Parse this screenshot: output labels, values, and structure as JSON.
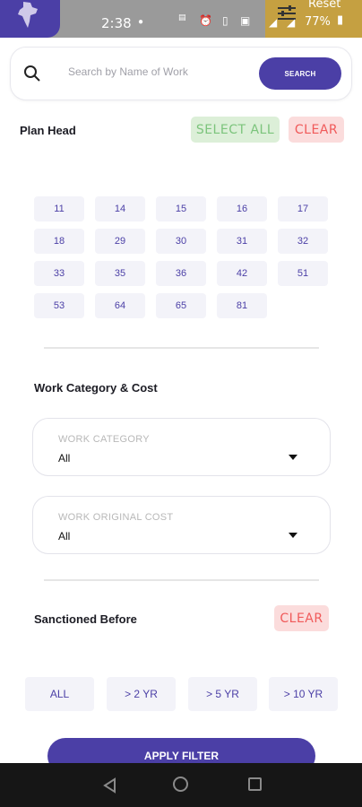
{
  "status_bar": {
    "time": "2:38",
    "battery": "77%",
    "reset_label": "Reset"
  },
  "search": {
    "placeholder": "Search by Name of Work",
    "button_label": "SEARCH"
  },
  "plan_head": {
    "title": "Plan Head",
    "select_all_label": "SELECT ALL",
    "clear_label": "CLEAR",
    "codes": [
      "11",
      "14",
      "15",
      "16",
      "17",
      "18",
      "29",
      "30",
      "31",
      "32",
      "33",
      "35",
      "36",
      "42",
      "51",
      "53",
      "64",
      "65",
      "81"
    ]
  },
  "work_category_cost": {
    "title": "Work Category & Cost",
    "category": {
      "label": "WORK CATEGORY",
      "value": "All"
    },
    "original_cost": {
      "label": "WORK ORIGINAL COST",
      "value": "All"
    }
  },
  "sanctioned_before": {
    "title": "Sanctioned Before",
    "clear_label": "CLEAR",
    "options": [
      "ALL",
      "> 2 YR",
      "> 5 YR",
      "> 10 YR"
    ]
  },
  "apply_button_label": "APPLY FILTER",
  "colors": {
    "primary": "#4b3fa6",
    "select_all_bg": "#dcefd8",
    "clear_bg": "#fbdcdc"
  }
}
